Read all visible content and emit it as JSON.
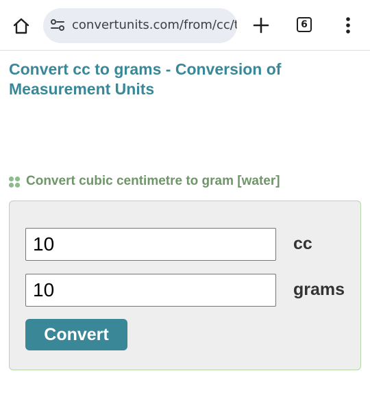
{
  "browser": {
    "url": "convertunits.com/from/cc/t",
    "tab_count": "6",
    "icons": {
      "home": "home-icon",
      "site_info": "tune-icon",
      "new_tab": "plus-icon",
      "tabs": "tab-switcher-icon",
      "menu": "more-vert-icon"
    }
  },
  "page": {
    "title": "Convert cc to grams - Conversion of Measurement Units",
    "section_heading": "Convert cubic centimetre to gram [water]",
    "heading_icon": "four-dots-icon"
  },
  "converter": {
    "from_value": "10",
    "from_unit": "cc",
    "to_value": "10",
    "to_unit": "grams",
    "convert_label": "Convert"
  },
  "colors": {
    "title": "#3a8897",
    "heading": "#6f9668",
    "button": "#3a8897",
    "panel_bg": "#eeeeee",
    "panel_border": "#b6d7a8",
    "url_box": "#e9ecf2"
  }
}
